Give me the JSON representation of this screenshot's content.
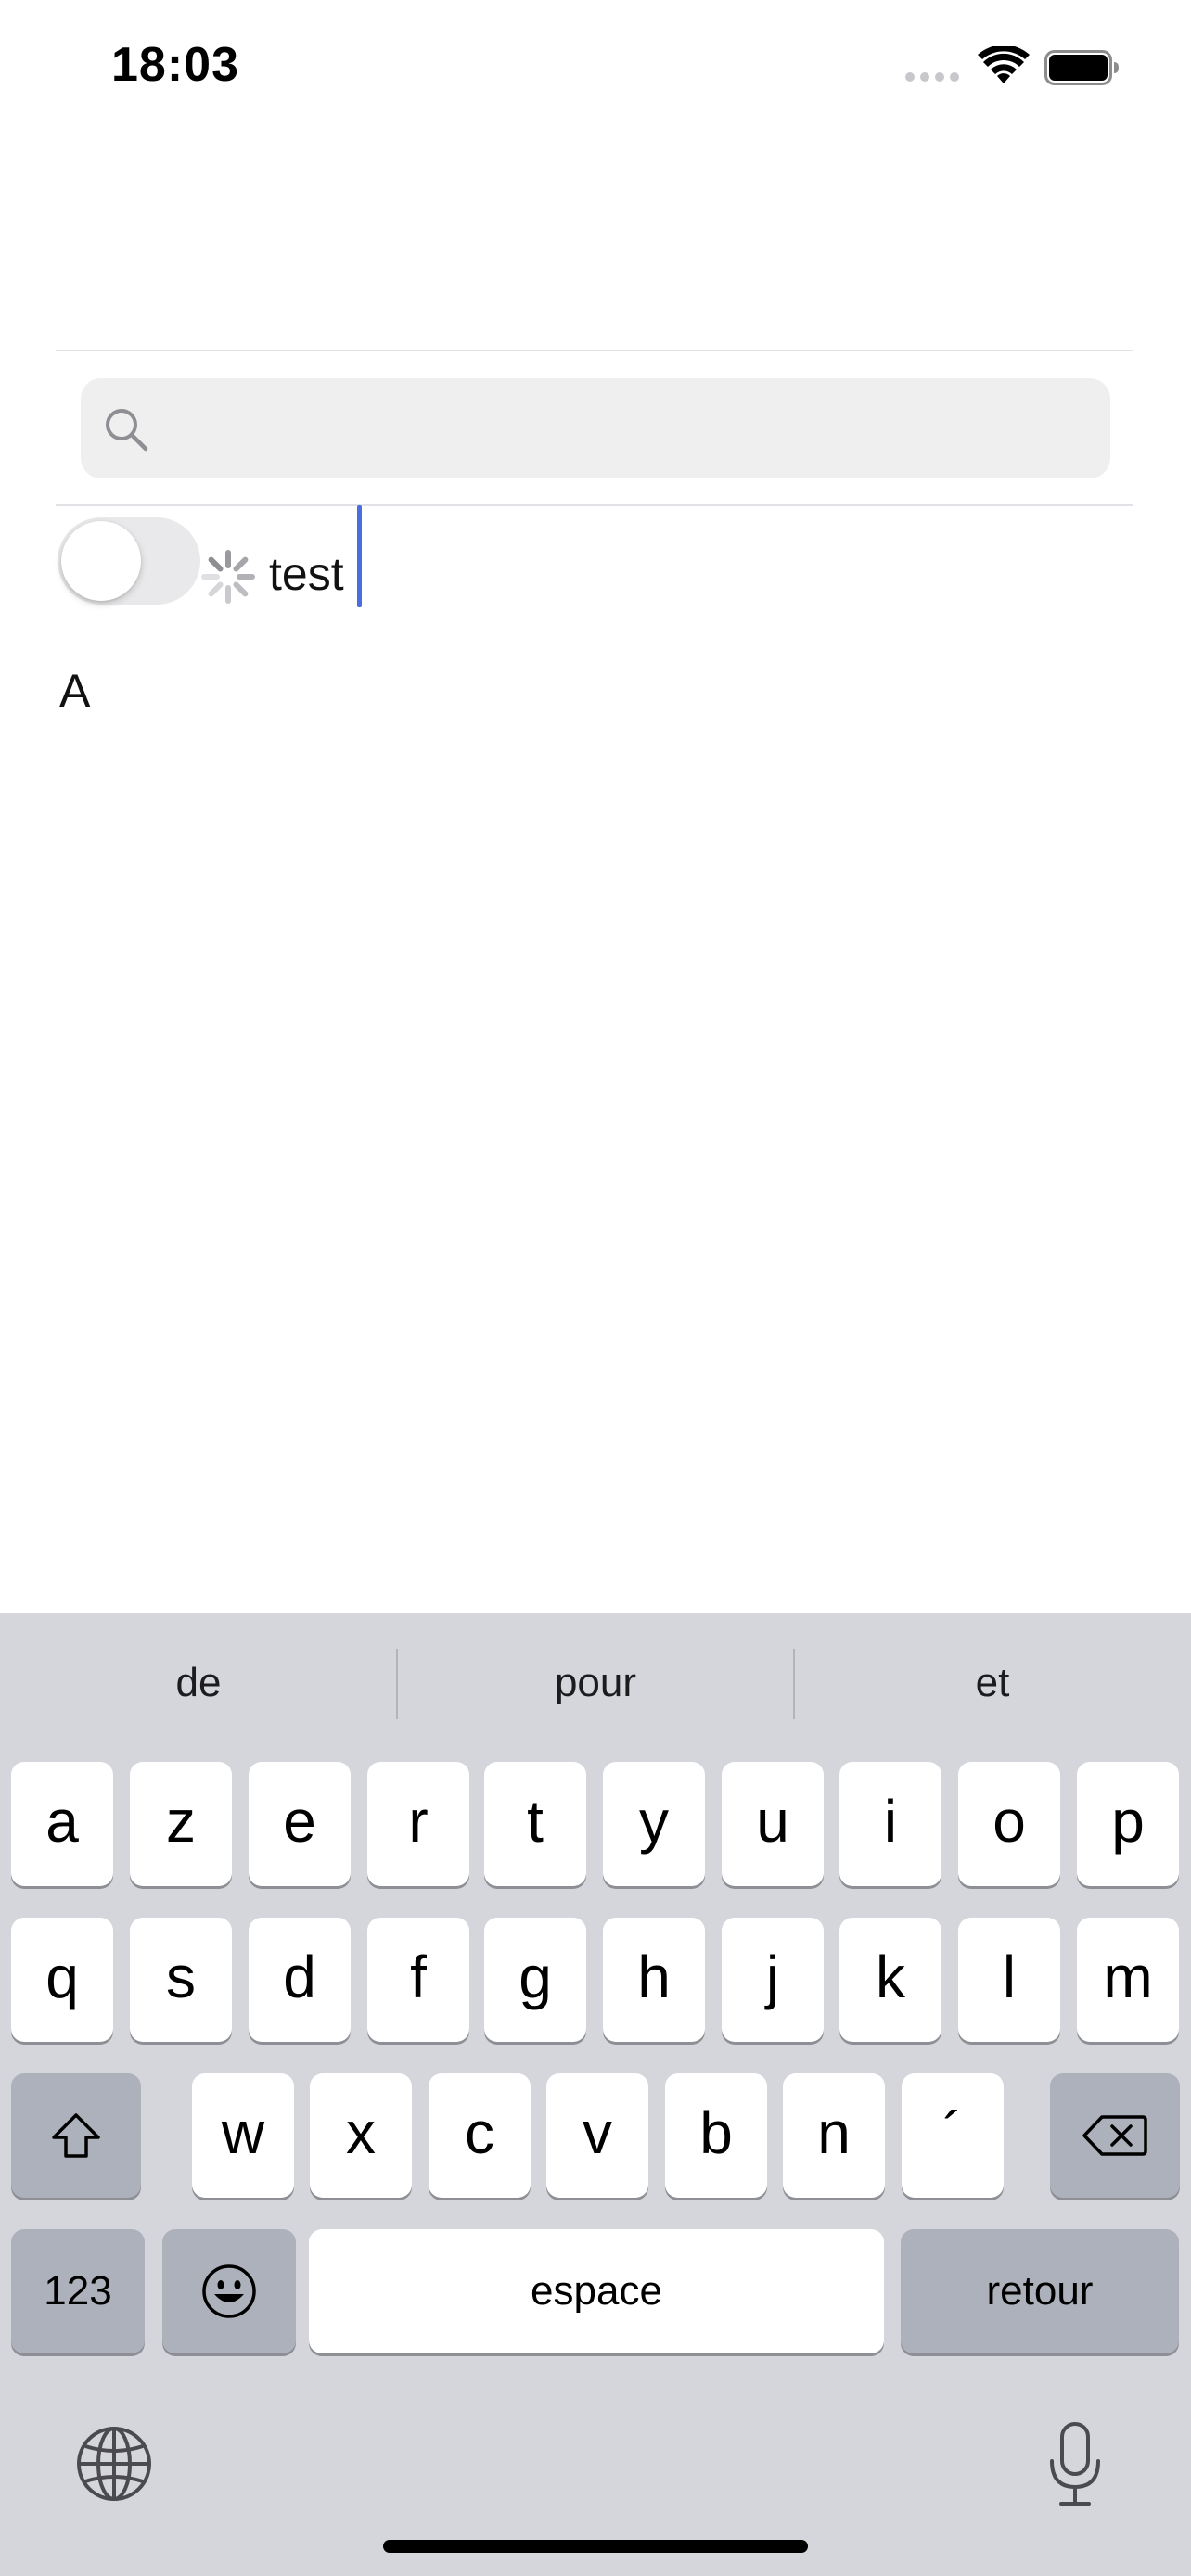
{
  "status_bar": {
    "time": "18:03"
  },
  "search": {
    "placeholder": "",
    "icon": "search-icon"
  },
  "row": {
    "toggle_on": false,
    "text_value": "test",
    "spinner_icon": "activity-spinner-icon"
  },
  "section": {
    "label": "A"
  },
  "keyboard": {
    "suggestions": [
      "de",
      "pour",
      "et"
    ],
    "row1": [
      "a",
      "z",
      "e",
      "r",
      "t",
      "y",
      "u",
      "i",
      "o",
      "p"
    ],
    "row2": [
      "q",
      "s",
      "d",
      "f",
      "g",
      "h",
      "j",
      "k",
      "l",
      "m"
    ],
    "row3": [
      "w",
      "x",
      "c",
      "v",
      "b",
      "n",
      "´"
    ],
    "numbers_label": "123",
    "space_label": "espace",
    "return_label": "retour",
    "shift_icon": "shift-icon",
    "delete_icon": "delete-icon",
    "emoji_icon": "emoji-icon",
    "globe_icon": "globe-icon",
    "mic_icon": "microphone-icon"
  },
  "colors": {
    "caret": "#4a6ee0",
    "keyboard_bg": "#d5d6dc",
    "function_key": "#adb1bb",
    "search_bg": "#efeff0"
  }
}
